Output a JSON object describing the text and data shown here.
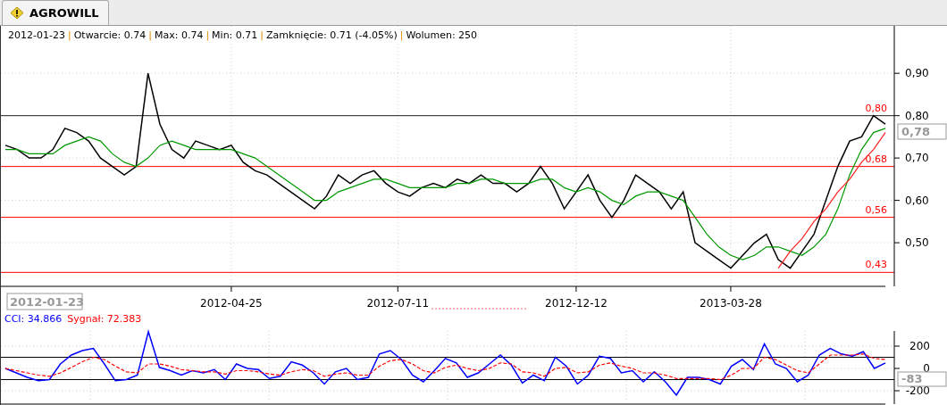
{
  "tab": {
    "label": "AGROWILL",
    "selected": true
  },
  "info_line": {
    "separator": "|",
    "items": [
      "2012-01-23",
      "Otwarcie: 0.74",
      "Max: 0.74",
      "Min: 0.71",
      "Zamknięcie: 0.71 (-4.05%)",
      "Wolumen: 250"
    ]
  },
  "price_chart": {
    "chart_data": {
      "type": "line",
      "grid": true,
      "categories": [
        null,
        null,
        null,
        null,
        null,
        null,
        null,
        null,
        null,
        null,
        null,
        null,
        null,
        null,
        null,
        null,
        null,
        null,
        null,
        "2012-04-25",
        null,
        null,
        null,
        null,
        null,
        null,
        null,
        null,
        null,
        null,
        null,
        null,
        null,
        "2012-07-11",
        null,
        null,
        null,
        null,
        null,
        null,
        null,
        null,
        null,
        null,
        null,
        null,
        null,
        null,
        "2012-12-12",
        null,
        null,
        null,
        null,
        null,
        null,
        null,
        null,
        null,
        null,
        null,
        null,
        "2013-03-28",
        null,
        null,
        null,
        null,
        null,
        null,
        null,
        null,
        null,
        null,
        null,
        null,
        null
      ],
      "yticks": [
        {
          "value": 0.5,
          "label": "0,50"
        },
        {
          "value": 0.6,
          "label": "0,60"
        },
        {
          "value": 0.7,
          "label": "0,70"
        },
        {
          "value": 0.8,
          "label": "0,80"
        },
        {
          "value": 0.9,
          "label": "0,90"
        }
      ],
      "ylim": [
        0.397,
        1.012
      ],
      "series": [
        {
          "color": "#000000",
          "values": [
            0.73,
            0.72,
            0.7,
            0.7,
            0.72,
            0.77,
            0.76,
            0.74,
            0.7,
            0.68,
            0.66,
            0.68,
            0.9,
            0.78,
            0.72,
            0.7,
            0.74,
            0.73,
            0.72,
            0.73,
            0.69,
            0.67,
            0.66,
            0.64,
            0.62,
            0.6,
            0.58,
            0.61,
            0.66,
            0.64,
            0.66,
            0.67,
            0.64,
            0.62,
            0.61,
            0.63,
            0.64,
            0.63,
            0.65,
            0.64,
            0.66,
            0.64,
            0.64,
            0.62,
            0.64,
            0.68,
            0.64,
            0.58,
            0.62,
            0.66,
            0.6,
            0.56,
            0.6,
            0.66,
            0.64,
            0.62,
            0.58,
            0.62,
            0.5,
            0.48,
            0.46,
            0.44,
            0.47,
            0.5,
            0.52,
            0.46,
            0.44,
            0.48,
            0.52,
            0.6,
            0.68,
            0.74,
            0.75,
            0.8,
            0.78
          ]
        },
        {
          "color": "#009900",
          "values": [
            0.72,
            0.72,
            0.71,
            0.71,
            0.71,
            0.73,
            0.74,
            0.75,
            0.74,
            0.71,
            0.69,
            0.68,
            0.7,
            0.73,
            0.74,
            0.73,
            0.72,
            0.72,
            0.72,
            0.72,
            0.71,
            0.7,
            0.68,
            0.66,
            0.64,
            0.62,
            0.6,
            0.6,
            0.62,
            0.63,
            0.64,
            0.65,
            0.65,
            0.64,
            0.63,
            0.63,
            0.63,
            0.63,
            0.64,
            0.64,
            0.65,
            0.65,
            0.64,
            0.64,
            0.64,
            0.65,
            0.65,
            0.63,
            0.62,
            0.63,
            0.62,
            0.6,
            0.59,
            0.61,
            0.62,
            0.62,
            0.61,
            0.6,
            0.56,
            0.52,
            0.49,
            0.47,
            0.46,
            0.47,
            0.49,
            0.49,
            0.48,
            0.47,
            0.49,
            0.52,
            0.58,
            0.66,
            0.72,
            0.76,
            0.77
          ]
        },
        {
          "color": "#ff2020",
          "values": [
            null,
            null,
            null,
            null,
            null,
            null,
            null,
            null,
            null,
            null,
            null,
            null,
            null,
            null,
            null,
            null,
            null,
            null,
            null,
            null,
            null,
            null,
            null,
            null,
            null,
            null,
            null,
            null,
            null,
            null,
            null,
            null,
            null,
            null,
            null,
            null,
            null,
            null,
            null,
            null,
            null,
            null,
            null,
            null,
            null,
            null,
            null,
            null,
            null,
            null,
            null,
            null,
            null,
            null,
            null,
            null,
            null,
            null,
            null,
            null,
            null,
            null,
            null,
            null,
            null,
            0.44,
            0.48,
            0.51,
            0.55,
            0.58,
            0.62,
            0.65,
            0.69,
            0.72,
            0.76
          ]
        }
      ],
      "ref_lines": [
        {
          "axis": "y",
          "value": 0.8,
          "label": "0,80",
          "color": "#222222"
        },
        {
          "axis": "y",
          "value": 0.68,
          "label": "0,68",
          "color": "#ff0000"
        },
        {
          "axis": "y",
          "value": 0.56,
          "label": "0,56",
          "color": "#ff0000"
        },
        {
          "axis": "y",
          "value": 0.43,
          "label": "0,43",
          "color": "#ff0000"
        }
      ]
    },
    "current_value": "0,78",
    "crosshair_date": "2012-01-23"
  },
  "cci_chart": {
    "legend": [
      {
        "label": "CCI: 34.866",
        "color": "#0000ff"
      },
      {
        "label": "Sygnał: 72.383",
        "color": "#ff0000"
      }
    ],
    "chart_data": {
      "type": "line",
      "grid": true,
      "yticks": [
        {
          "value": 200,
          "label": "200"
        },
        {
          "value": 0,
          "label": "0"
        },
        {
          "value": -200,
          "label": "-200"
        }
      ],
      "ylim": [
        -320,
        336
      ],
      "series": [
        {
          "color": "#0000ff",
          "values": [
            0,
            -40,
            -80,
            -110,
            -100,
            40,
            120,
            160,
            180,
            40,
            -110,
            -100,
            -60,
            330,
            10,
            -20,
            -60,
            -20,
            -40,
            -10,
            -100,
            40,
            0,
            -10,
            -90,
            -70,
            60,
            30,
            -40,
            -140,
            -30,
            0,
            -100,
            -80,
            130,
            160,
            80,
            -60,
            -120,
            -20,
            90,
            50,
            -80,
            -40,
            40,
            120,
            30,
            -130,
            -60,
            -110,
            100,
            20,
            -140,
            -60,
            110,
            90,
            -40,
            -20,
            -120,
            -30,
            -120,
            -240,
            -80,
            -80,
            -100,
            -140,
            20,
            80,
            -10,
            220,
            40,
            0,
            -120,
            -60,
            120,
            180,
            130,
            110,
            150,
            0,
            50
          ]
        },
        {
          "color": "#ff0000",
          "line_style": "dashed",
          "values": [
            0,
            -20,
            -40,
            -60,
            -70,
            -40,
            10,
            60,
            100,
            80,
            20,
            -30,
            -40,
            40,
            40,
            20,
            -10,
            -20,
            -30,
            -30,
            -50,
            -20,
            -20,
            -30,
            -50,
            -60,
            -30,
            -10,
            -20,
            -70,
            -50,
            -40,
            -60,
            -60,
            20,
            70,
            80,
            40,
            -20,
            -40,
            10,
            30,
            0,
            -20,
            0,
            50,
            40,
            -30,
            -40,
            -70,
            0,
            10,
            -40,
            -30,
            30,
            50,
            20,
            0,
            -40,
            -40,
            -60,
            -90,
            -90,
            -90,
            -90,
            -100,
            -60,
            0,
            0,
            100,
            80,
            30,
            -20,
            -40,
            40,
            120,
            120,
            120,
            130,
            90,
            80
          ]
        }
      ],
      "ref_lines": [
        {
          "axis": "y",
          "value": 100,
          "color": "#000000"
        },
        {
          "axis": "y",
          "value": -100,
          "color": "#000000"
        }
      ]
    },
    "current_value": "-83"
  }
}
